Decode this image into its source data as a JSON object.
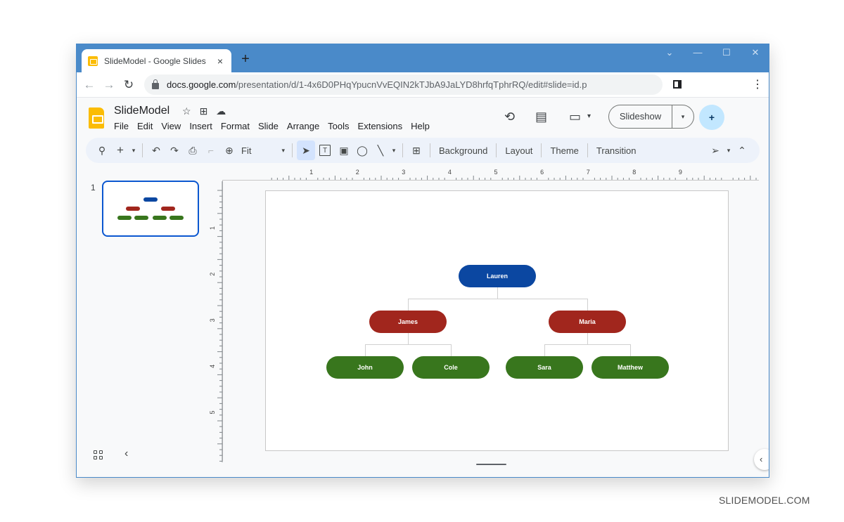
{
  "browser": {
    "tab_title": "SlideModel - Google Slides",
    "tab_close": "×",
    "new_tab": "+",
    "window_controls": {
      "tab_search": "⌄",
      "minimize": "—",
      "maximize": "☐",
      "close": "✕"
    },
    "nav": {
      "back": "←",
      "forward": "→",
      "reload": "↻"
    },
    "url_host": "docs.google.com",
    "url_path": "/presentation/d/1-4x6D0PHqYpucnVvEQIN2kTJbA9JaLYD8hrfqTphrRQ/edit#slide=id.p",
    "menu_icon": "⋮"
  },
  "app": {
    "doc_title": "SlideModel",
    "title_icons": {
      "star": "☆",
      "move": "⊞",
      "cloud": "☁"
    },
    "menu": [
      "File",
      "Edit",
      "View",
      "Insert",
      "Format",
      "Slide",
      "Arrange",
      "Tools",
      "Extensions",
      "Help"
    ],
    "header_icons": {
      "history": "⟲",
      "comments": "▤",
      "meet": "▭",
      "meet_caret": "▾"
    },
    "slideshow_label": "Slideshow",
    "slideshow_caret": "▾",
    "share_icon": "+"
  },
  "toolbar": {
    "search": "⚲",
    "new": "+",
    "new_caret": "▾",
    "undo": "↶",
    "redo": "↷",
    "print": "⎙",
    "paint_format": "⌐",
    "zoom_icon": "⊕",
    "zoom_value": "Fit",
    "zoom_caret": "▾",
    "select": "➤",
    "textbox": "T",
    "image": "▣",
    "shape": "◯",
    "line": "╲",
    "line_caret": "▾",
    "comment": "⊞",
    "background_label": "Background",
    "layout_label": "Layout",
    "theme_label": "Theme",
    "transition_label": "Transition",
    "mode_icon": "➢",
    "mode_caret": "▾",
    "collapse": "⌃"
  },
  "filmstrip": {
    "slide_number": "1",
    "collapse_icon": "‹"
  },
  "rulers": {
    "horizontal": [
      "1",
      "2",
      "3",
      "4",
      "5",
      "6",
      "7",
      "8",
      "9"
    ],
    "vertical": [
      "1",
      "2",
      "3",
      "4",
      "5"
    ]
  },
  "org_chart": {
    "colors": {
      "root": "#0b47a1",
      "level1": "#a1261d",
      "level2": "#38761d"
    },
    "root": {
      "name": "Lauren"
    },
    "level1": [
      {
        "name": "James",
        "children": [
          "John",
          "Cole"
        ]
      },
      {
        "name": "Maria",
        "children": [
          "Sara",
          "Matthew"
        ]
      }
    ]
  },
  "side_panel_toggle": "‹",
  "watermark": "SLIDEMODEL.COM"
}
